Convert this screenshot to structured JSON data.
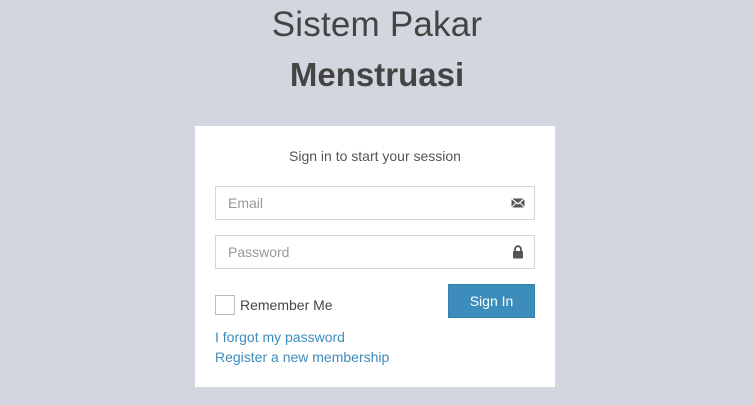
{
  "logo": {
    "line1": "Sistem Pakar",
    "line2": "Menstruasi"
  },
  "login": {
    "message": "Sign in to start your session",
    "email": {
      "placeholder": "Email",
      "value": "",
      "icon": "envelope-icon"
    },
    "password": {
      "placeholder": "Password",
      "value": "",
      "icon": "lock-icon"
    },
    "remember_label": "Remember Me",
    "remember_checked": false,
    "signin_label": "Sign In",
    "forgot_link": "I forgot my password",
    "register_link": "Register a new membership"
  },
  "colors": {
    "background": "#d2d6de",
    "primary": "#3c8dbc",
    "text": "#444444"
  }
}
